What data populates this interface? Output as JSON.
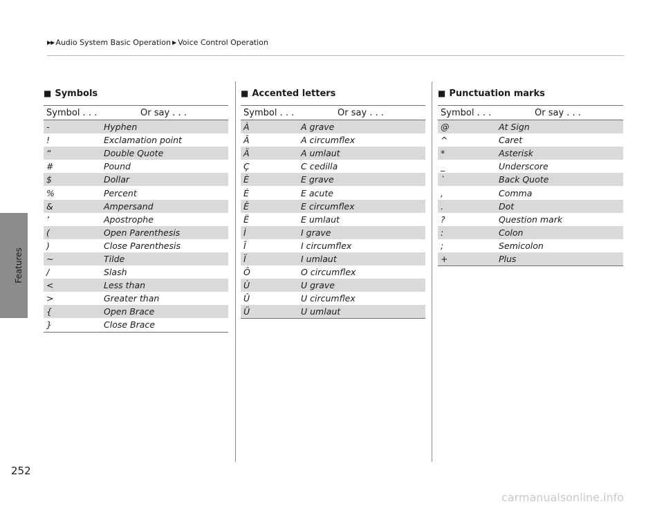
{
  "breadcrumb": {
    "items": [
      "Audio System Basic Operation",
      "Voice Control Operation"
    ]
  },
  "side_label": "Features",
  "page_number": "252",
  "watermark": "carmanualsonline.info",
  "headers": {
    "symbol": "Symbol . . .",
    "or_say": "Or say . . ."
  },
  "sections": [
    {
      "title": "Symbols",
      "rows": [
        {
          "symbol": "-",
          "say": "Hyphen"
        },
        {
          "symbol": "!",
          "say": "Exclamation point"
        },
        {
          "symbol": "“",
          "say": "Double Quote"
        },
        {
          "symbol": "#",
          "say": "Pound"
        },
        {
          "symbol": "$",
          "say": "Dollar"
        },
        {
          "symbol": "%",
          "say": "Percent"
        },
        {
          "symbol": "&",
          "say": "Ampersand"
        },
        {
          "symbol": "’",
          "say": "Apostrophe"
        },
        {
          "symbol": "(",
          "say": "Open Parenthesis"
        },
        {
          "symbol": ")",
          "say": "Close Parenthesis"
        },
        {
          "symbol": "~",
          "say": "Tilde"
        },
        {
          "symbol": "/",
          "say": "Slash"
        },
        {
          "symbol": "<",
          "say": "Less than"
        },
        {
          "symbol": ">",
          "say": "Greater than"
        },
        {
          "symbol": "{",
          "say": "Open Brace"
        },
        {
          "symbol": "}",
          "say": "Close Brace"
        }
      ]
    },
    {
      "title": "Accented letters",
      "rows": [
        {
          "symbol": "À",
          "say": "A grave"
        },
        {
          "symbol": "Â",
          "say": "A circumflex"
        },
        {
          "symbol": "Ä",
          "say": "A umlaut"
        },
        {
          "symbol": "Ç",
          "say": "C cedilla"
        },
        {
          "symbol": "È",
          "say": "E grave"
        },
        {
          "symbol": "É",
          "say": "E acute"
        },
        {
          "symbol": "Ê",
          "say": "E circumflex"
        },
        {
          "symbol": "Ë",
          "say": "E umlaut"
        },
        {
          "symbol": "Ì",
          "say": "I grave"
        },
        {
          "symbol": "Î",
          "say": "I circumflex"
        },
        {
          "symbol": "Ï",
          "say": "I umlaut"
        },
        {
          "symbol": "Ô",
          "say": "O circumflex"
        },
        {
          "symbol": "Ù",
          "say": "U grave"
        },
        {
          "symbol": "Û",
          "say": "U circumflex"
        },
        {
          "symbol": "Ü",
          "say": "U umlaut"
        }
      ]
    },
    {
      "title": "Punctuation marks",
      "rows": [
        {
          "symbol": "@",
          "say": "At Sign"
        },
        {
          "symbol": "^",
          "say": "Caret"
        },
        {
          "symbol": "*",
          "say": "Asterisk"
        },
        {
          "symbol": "_",
          "say": "Underscore"
        },
        {
          "symbol": "`",
          "say": "Back Quote"
        },
        {
          "symbol": ",",
          "say": "Comma"
        },
        {
          "symbol": ".",
          "say": "Dot"
        },
        {
          "symbol": "?",
          "say": "Question mark"
        },
        {
          "symbol": ":",
          "say": "Colon"
        },
        {
          "symbol": ";",
          "say": "Semicolon"
        },
        {
          "symbol": "+",
          "say": "Plus"
        }
      ]
    }
  ]
}
